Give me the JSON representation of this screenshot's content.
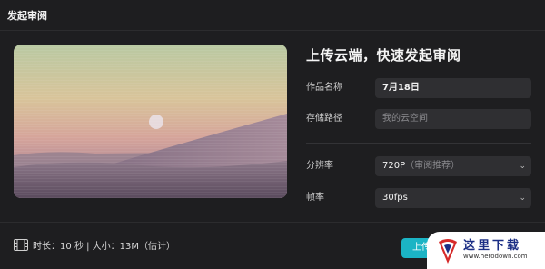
{
  "window": {
    "title": "发起审阅"
  },
  "form": {
    "heading": "上传云端，快速发起审阅",
    "name_label": "作品名称",
    "name_value": "7月18日",
    "path_label": "存储路径",
    "path_placeholder": "我的云空间",
    "resolution_label": "分辨率",
    "resolution_value": "720P",
    "resolution_hint": "（审阅推荐）",
    "fps_label": "帧率",
    "fps_value": "30fps"
  },
  "footer": {
    "info": "时长：10 秒 | 大小：13M（估计）",
    "upload_label": "上传"
  },
  "watermark": {
    "text": "这里下载",
    "url": "www.herodown.com"
  },
  "colors": {
    "accent": "#1bb4c5",
    "background": "#1e1e20",
    "field": "#2f2f32"
  },
  "icons": {
    "film": "film-icon",
    "chevron": "chevron-down-icon"
  }
}
